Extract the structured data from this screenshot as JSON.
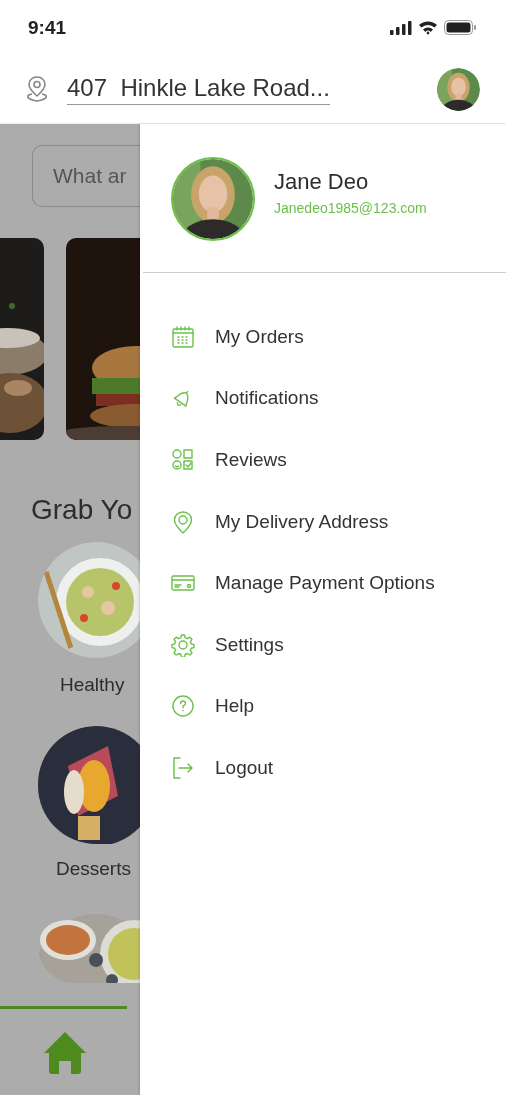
{
  "status_bar": {
    "time": "9:41"
  },
  "header": {
    "address": "407  Hinkle Lake Road..."
  },
  "background": {
    "search": {
      "placeholder": "What ar"
    },
    "banners": [
      {
        "kind": "picture"
      },
      {
        "kind": "picture"
      }
    ],
    "heading": "Grab Yo",
    "categories": [
      {
        "kind": "picture",
        "label": "Healthy"
      },
      {
        "kind": "picture",
        "label": "Desserts"
      },
      {
        "kind": "picture"
      }
    ]
  },
  "bottom_nav": {
    "items": [
      {
        "selected": true
      }
    ]
  },
  "drawer": {
    "profile": {
      "name": "Jane Deo",
      "email": "Janedeo1985@123.com"
    },
    "menu": [
      {
        "label": "My Orders"
      },
      {
        "label": "Notifications"
      },
      {
        "label": "Reviews"
      },
      {
        "label": "My Delivery Address"
      },
      {
        "label": "Manage Payment Options"
      },
      {
        "label": "Settings"
      },
      {
        "label": "Help"
      },
      {
        "label": "Logout"
      }
    ]
  }
}
